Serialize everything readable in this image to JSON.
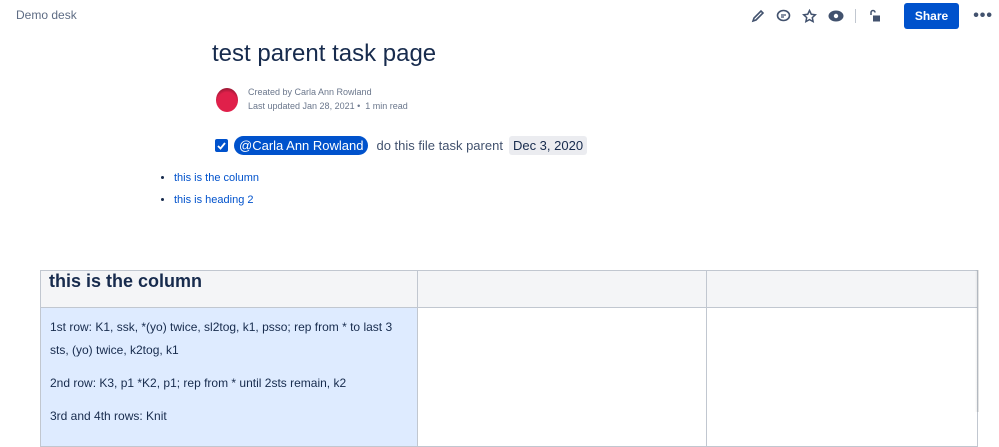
{
  "header": {
    "space": "Demo desk",
    "share_label": "Share",
    "more_label": "•••",
    "icons": [
      "edit-icon",
      "comment-icon",
      "star-icon",
      "watch-icon",
      "restrictions-icon"
    ]
  },
  "page": {
    "title": "test parent task page",
    "created_by": "Created by Carla Ann Rowland",
    "last_updated": "Last updated Jan 28, 2021",
    "read_time": "1 min read"
  },
  "task": {
    "checked": true,
    "mention": "@Carla Ann Rowland",
    "text": "do this file task parent",
    "date": "Dec 3, 2020"
  },
  "toc": [
    "this is the column",
    "this is heading 2"
  ],
  "table": {
    "headers": [
      "this is the column",
      "",
      ""
    ],
    "cell_lines": [
      "1st row: K1, ssk, *(yo) twice, sl2tog, k1, psso; rep from * to last 3 sts, (yo) twice, k2tog, k1",
      "2nd row: K3, p1 *K2, p1; rep from * until 2sts remain, k2",
      "3rd and 4th rows: Knit"
    ]
  }
}
